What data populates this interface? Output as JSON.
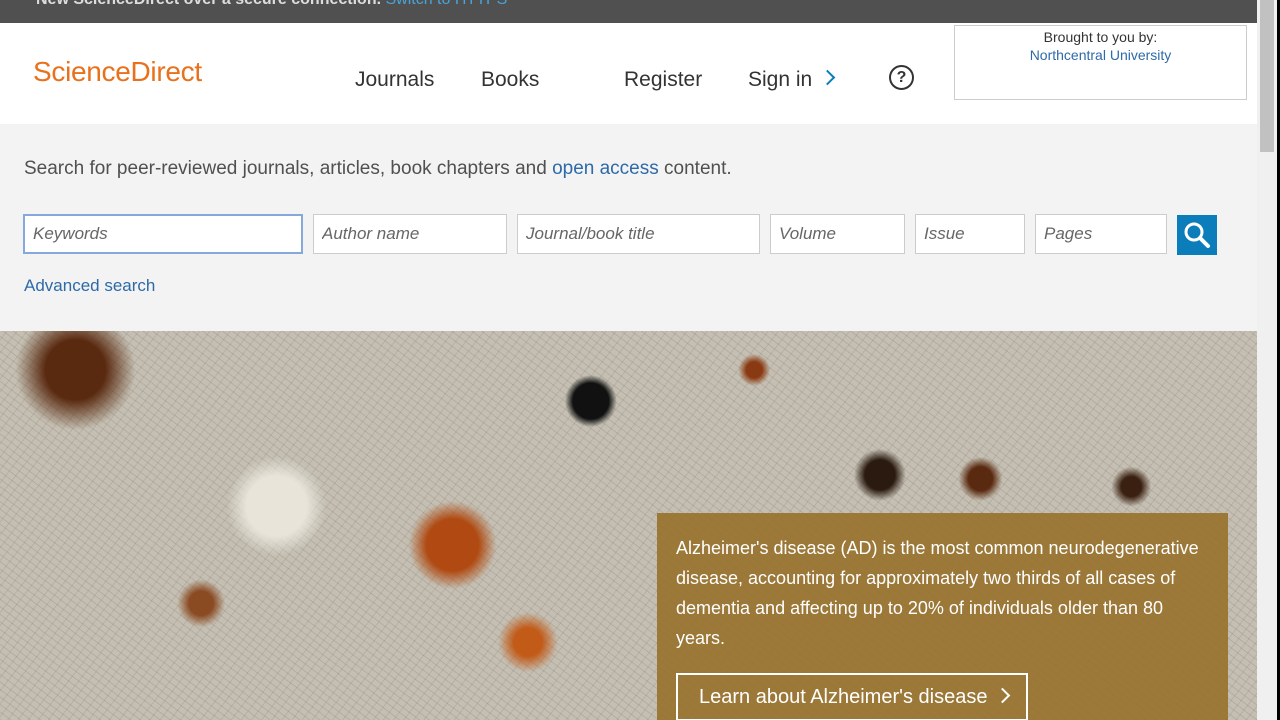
{
  "notice": {
    "text": "New ScienceDirect over a secure connection.",
    "link": "Switch to HTTPS"
  },
  "header": {
    "logo": "ScienceDirect",
    "nav": {
      "journals": "Journals",
      "books": "Books",
      "register": "Register",
      "sign_in": "Sign in"
    },
    "help_icon": "question-circle-icon",
    "brought_to_you": {
      "label": "Brought to you by:",
      "institution": "Northcentral University"
    }
  },
  "search": {
    "intro_before": "Search for peer-reviewed journals, articles, book chapters and ",
    "intro_link": "open access",
    "intro_after": " content.",
    "fields": {
      "keywords": "Keywords",
      "author": "Author name",
      "journal": "Journal/book title",
      "volume": "Volume",
      "issue": "Issue",
      "pages": "Pages"
    },
    "button_icon": "search-icon",
    "advanced": "Advanced search"
  },
  "hero": {
    "description": "Alzheimer's disease (AD) is the most common neurodegenerative disease, accounting for approximately two thirds of all cases of dementia and affecting up to 20% of individuals older than 80 years.",
    "button": "Learn about Alzheimer's disease"
  },
  "colors": {
    "brand": "#e9711c",
    "link": "#2e6aa8",
    "search_button": "#0c7dbb",
    "overlay": "#96702a"
  }
}
